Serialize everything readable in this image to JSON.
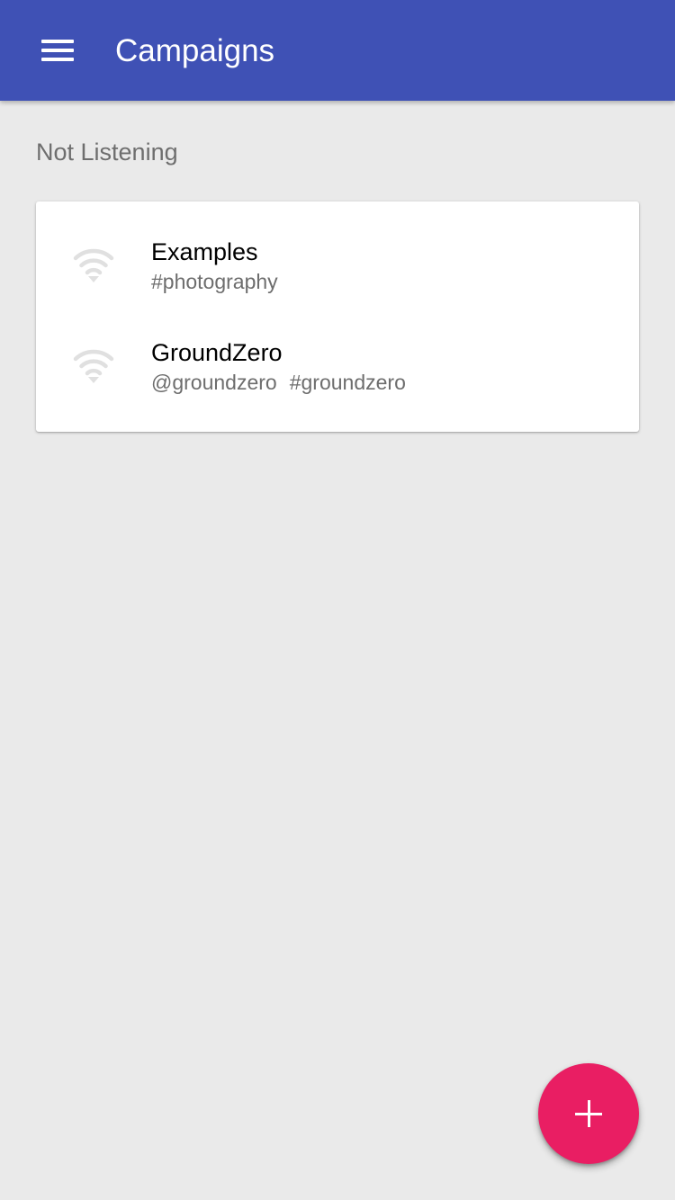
{
  "app_bar": {
    "title": "Campaigns",
    "menu_icon": "menu-icon",
    "color": "#3f51b5"
  },
  "section": {
    "title": "Not Listening"
  },
  "campaigns": [
    {
      "name": "Examples",
      "tags": [
        "#photography"
      ],
      "icon": "wifi-icon"
    },
    {
      "name": "GroundZero",
      "tags": [
        "@groundzero",
        "#groundzero"
      ],
      "icon": "wifi-icon"
    }
  ],
  "fab": {
    "icon": "plus-icon",
    "color": "#e91e63"
  },
  "colors": {
    "background": "#eaeaea",
    "icon_disabled": "#e0e0e0"
  }
}
